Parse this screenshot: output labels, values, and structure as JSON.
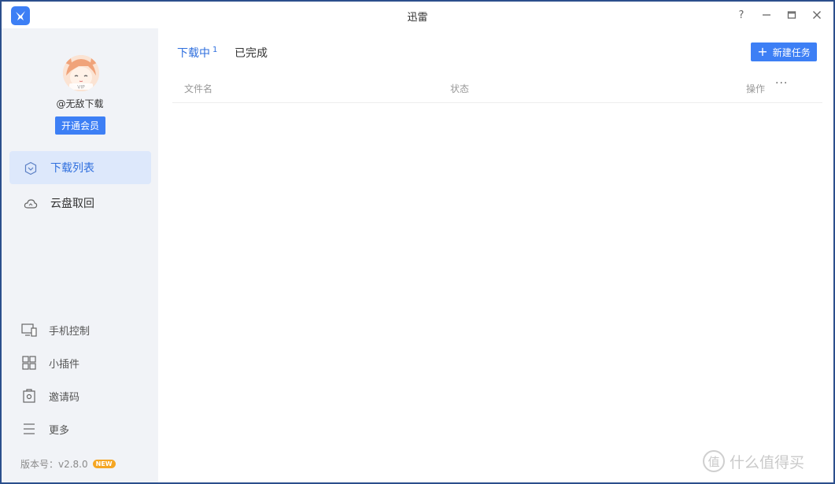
{
  "window": {
    "title": "迅雷"
  },
  "titlebar": {
    "help_icon": "question-icon",
    "minimize_icon": "minimize-icon",
    "maximize_icon": "maximize-icon",
    "close_icon": "close-icon"
  },
  "sidebar": {
    "username": "@无敌下载",
    "vip_button": "开通会员",
    "nav": [
      {
        "label": "下载列表",
        "icon": "download-icon",
        "active": true
      },
      {
        "label": "云盘取回",
        "icon": "cloud-icon",
        "active": false
      }
    ],
    "bottom": [
      {
        "label": "手机控制",
        "icon": "device-icon"
      },
      {
        "label": "小插件",
        "icon": "grid-icon"
      },
      {
        "label": "邀请码",
        "icon": "invite-icon"
      },
      {
        "label": "更多",
        "icon": "menu-icon"
      }
    ],
    "version": "版本号：v2.8.0",
    "new_badge": "NEW"
  },
  "main": {
    "tabs": [
      {
        "label": "下载中",
        "count": "1",
        "active": true
      },
      {
        "label": "已完成",
        "active": false
      }
    ],
    "new_task_button": "新建任务",
    "columns": {
      "filename": "文件名",
      "status": "状态",
      "actions": "操作"
    },
    "more": "···"
  },
  "watermark": {
    "text": "什么值得买",
    "logo": "值"
  },
  "colors": {
    "accent": "#3d7ff5",
    "active_bg": "#dde8fb",
    "sidebar_bg": "#f1f3f7"
  }
}
